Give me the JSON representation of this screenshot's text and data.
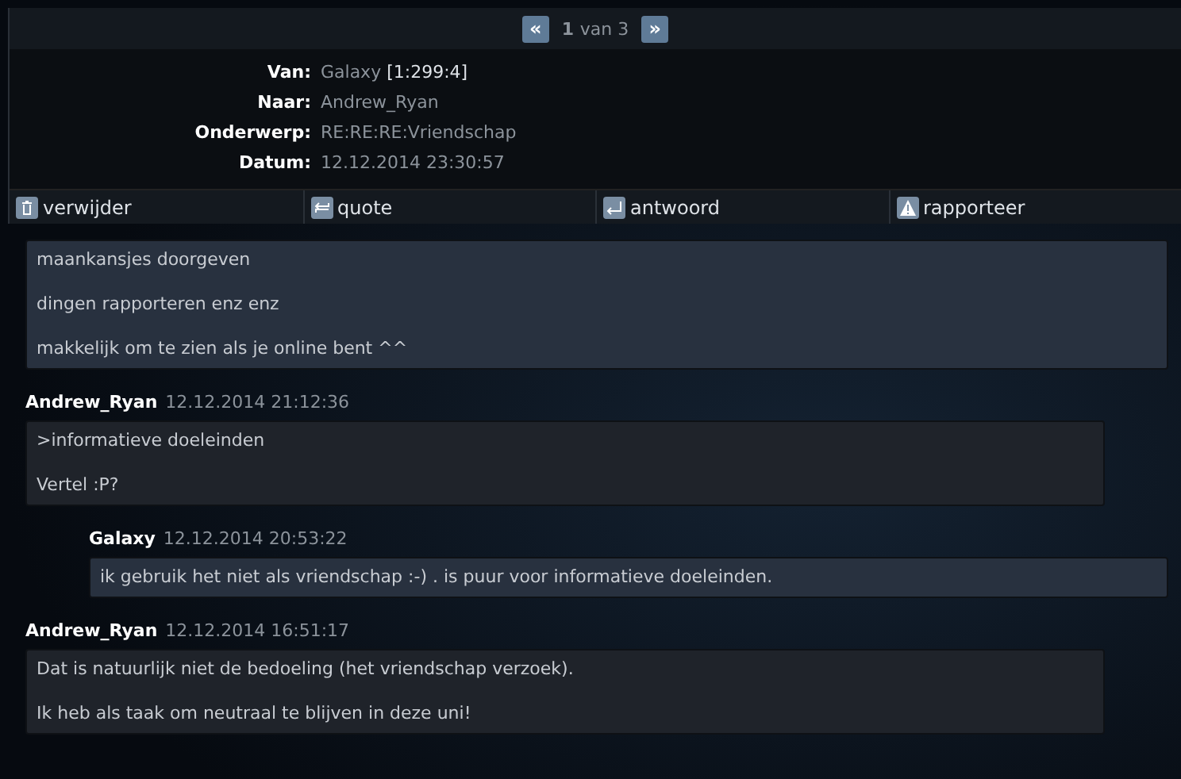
{
  "pagination": {
    "prev": "«",
    "current": "1",
    "of": "van 3",
    "next": "»"
  },
  "header": [
    {
      "label": "Van:",
      "value": "Galaxy",
      "extra": "[1:299:4]"
    },
    {
      "label": "Naar:",
      "value": "Andrew_Ryan"
    },
    {
      "label": "Onderwerp:",
      "value": "RE:RE:RE:Vriendschap"
    },
    {
      "label": "Datum:",
      "value": "12.12.2014 23:30:57"
    }
  ],
  "actions": [
    {
      "kind": "delete",
      "label": "verwijder"
    },
    {
      "kind": "quote",
      "label": "quote"
    },
    {
      "kind": "reply",
      "label": "antwoord"
    },
    {
      "kind": "report",
      "label": "rapporteer"
    }
  ],
  "messages": [
    {
      "kind": "own",
      "indented": false,
      "lines": [
        "maankansjes doorgeven",
        "dingen rapporteren enz enz",
        "makkelijk om te zien als je online bent ^^"
      ]
    },
    {
      "kind": "other",
      "indented": false,
      "author": "Andrew_Ryan",
      "date": "12.12.2014 21:12:36",
      "lines": [
        ">informatieve doeleinden",
        "Vertel :P?"
      ]
    },
    {
      "kind": "own",
      "indented": true,
      "author": "Galaxy",
      "date": "12.12.2014 20:53:22",
      "lines": [
        "ik gebruik het niet als vriendschap :-) . is puur voor informatieve doeleinden."
      ]
    },
    {
      "kind": "other",
      "indented": false,
      "author": "Andrew_Ryan",
      "date": "12.12.2014 16:51:17",
      "lines": [
        "Dat is natuurlijk niet de bedoeling (het vriendschap verzoek).",
        "Ik heb als taak om neutraal te blijven in deze uni!"
      ]
    }
  ]
}
